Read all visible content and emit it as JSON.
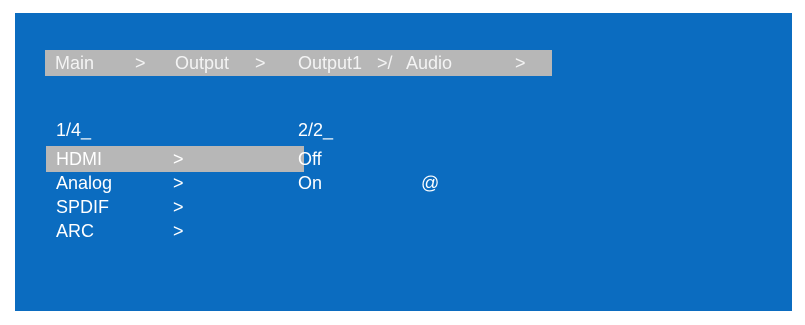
{
  "breadcrumb": {
    "items": [
      "Main",
      "Output",
      "Output1",
      "Audio"
    ],
    "separators": [
      ">",
      ">",
      ">/",
      ">"
    ]
  },
  "left_menu": {
    "page": "1/4_",
    "items": [
      {
        "label": "HDMI",
        "arrow": ">"
      },
      {
        "label": "Analog",
        "arrow": ">"
      },
      {
        "label": "SPDIF",
        "arrow": ">"
      },
      {
        "label": "ARC",
        "arrow": ">"
      }
    ],
    "selected_index": 0
  },
  "right_menu": {
    "page": "2/2_",
    "options": [
      {
        "label": "Off",
        "mark": ""
      },
      {
        "label": "On",
        "mark": "@"
      }
    ]
  },
  "colors": {
    "background": "#0b6cc0",
    "highlight": "#b7b7b7",
    "text": "#ffffff"
  }
}
